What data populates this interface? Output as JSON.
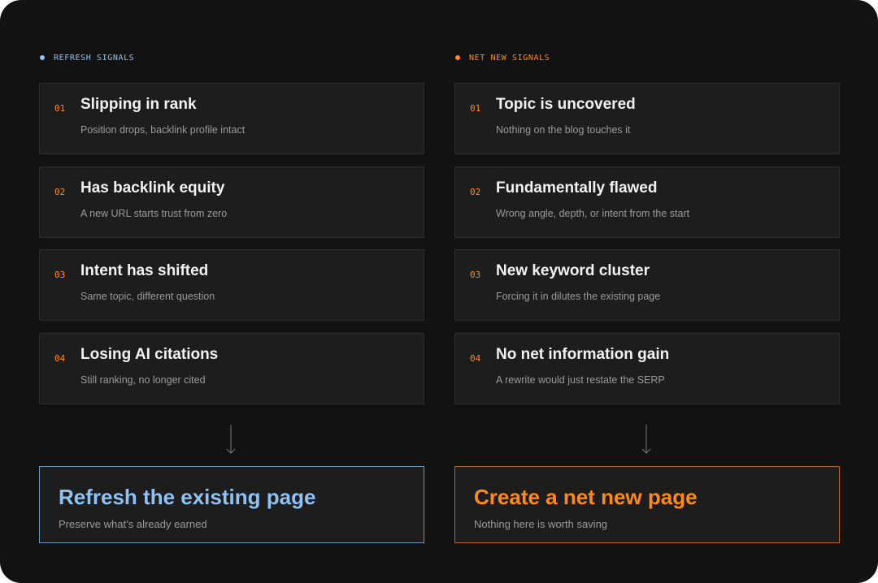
{
  "colors": {
    "background": "#121212",
    "card": "#1d1d1d",
    "refresh_accent": "#8fc2f2",
    "net_new_accent": "#ff8a1c"
  },
  "refresh": {
    "header": "REFRESH SIGNALS",
    "signals": [
      {
        "num": "01",
        "title": "Slipping in rank",
        "subtitle": "Position drops, backlink profile intact"
      },
      {
        "num": "02",
        "title": "Has backlink equity",
        "subtitle": "A new URL starts trust from zero"
      },
      {
        "num": "03",
        "title": "Intent has shifted",
        "subtitle": "Same topic, different question"
      },
      {
        "num": "04",
        "title": "Losing AI citations",
        "subtitle": "Still ranking, no longer cited"
      }
    ],
    "result": {
      "title": "Refresh the existing page",
      "subtitle": "Preserve what’s already earned"
    }
  },
  "net_new": {
    "header": "NET NEW SIGNALS",
    "signals": [
      {
        "num": "01",
        "title": "Topic is uncovered",
        "subtitle": "Nothing on the blog touches it"
      },
      {
        "num": "02",
        "title": "Fundamentally flawed",
        "subtitle": "Wrong angle, depth, or intent from the start"
      },
      {
        "num": "03",
        "title": "New keyword cluster",
        "subtitle": "Forcing it in dilutes the existing page"
      },
      {
        "num": "04",
        "title": "No net information gain",
        "subtitle": "A rewrite would just restate the SERP"
      }
    ],
    "result": {
      "title": "Create a net new page",
      "subtitle": "Nothing here is worth saving"
    }
  }
}
